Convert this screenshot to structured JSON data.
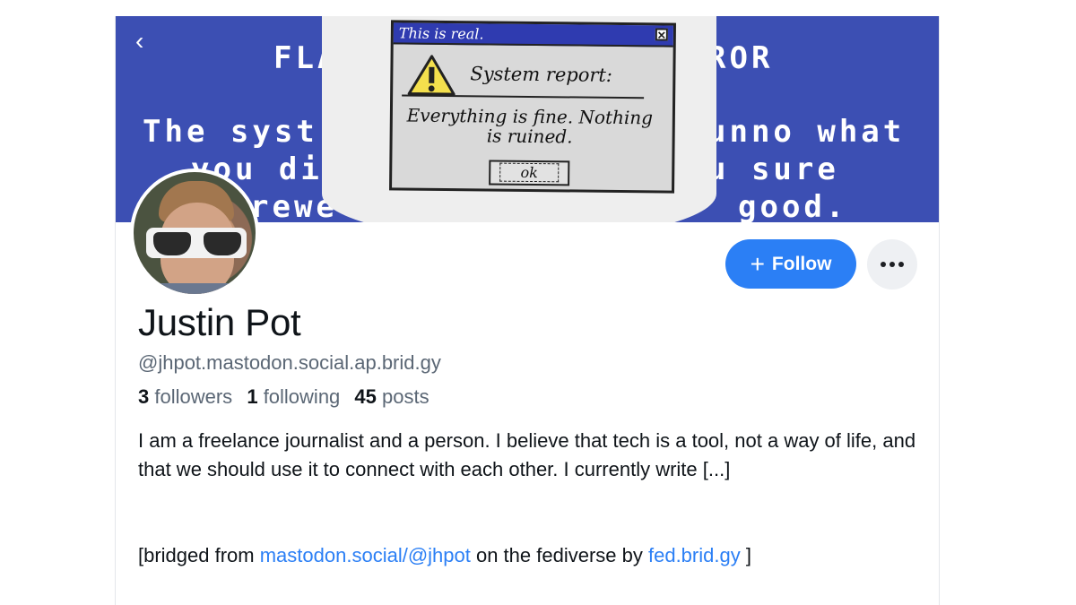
{
  "banner": {
    "bg_text_line1_left": "FLA",
    "bg_text_line1_right": "ROR",
    "bg_text_line2_left": "The syst",
    "bg_text_line2_right": "unno what",
    "bg_text_line3_left": "you di",
    "bg_text_line3_right": "u sure",
    "bg_text_line4_left": "rewe",
    "bg_text_line4_right": "good.",
    "dialog": {
      "title": "This is real.",
      "close": "✕",
      "heading": "System report:",
      "message": "Everything is fine. Nothing is ruined.",
      "ok": "ok"
    }
  },
  "nav": {
    "back_icon": "‹"
  },
  "profile": {
    "name": "Justin Pot",
    "handle": "@jhpot.mastodon.social.ap.brid.gy",
    "followers_count": "3",
    "followers_label": "followers",
    "following_count": "1",
    "following_label": "following",
    "posts_count": "45",
    "posts_label": "posts",
    "bio": "I am a freelance journalist and a person. I believe that tech is a tool, not a way of life, and that we should use it to connect with each other. I currently write [...]",
    "bridged_prefix": "[bridged from ",
    "bridged_link1": "mastodon.social/@jhpot",
    "bridged_middle": " on the fediverse by ",
    "bridged_link2": "fed.brid.gy",
    "bridged_suffix": " ]"
  },
  "actions": {
    "follow_plus": "+",
    "follow_label": "Follow"
  },
  "colors": {
    "accent": "#2b7ff5",
    "banner": "#3c4fb3"
  }
}
